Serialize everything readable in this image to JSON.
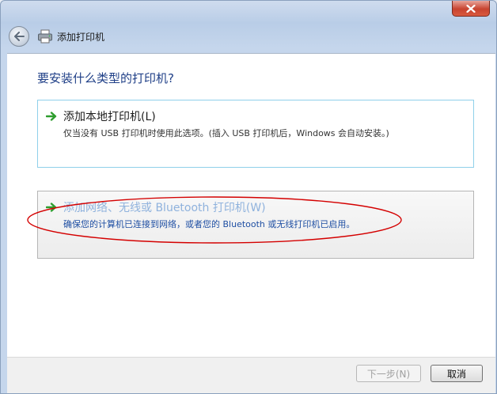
{
  "window": {
    "title": "添加打印机"
  },
  "main": {
    "heading": "要安装什么类型的打印机?",
    "options": [
      {
        "title": "添加本地打印机(L)",
        "description": "仅当没有 USB 打印机时使用此选项。(插入 USB 打印机后，Windows 会自动安装。)"
      },
      {
        "title": "添加网络、无线或 Bluetooth 打印机(W)",
        "description": "确保您的计算机已连接到网络，或者您的 Bluetooth 或无线打印机已启用。"
      }
    ]
  },
  "footer": {
    "next_label": "下一步(N)",
    "cancel_label": "取消"
  },
  "colors": {
    "accent_arrow": "#2e9d2e",
    "heading": "#1f3f87",
    "annotation": "#d40000"
  }
}
